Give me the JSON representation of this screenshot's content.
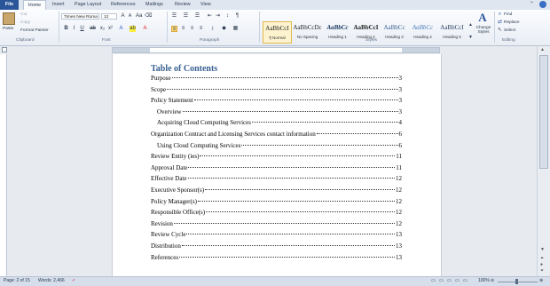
{
  "tabs": [
    "File",
    "Home",
    "Insert",
    "Page Layout",
    "References",
    "Mailings",
    "Review",
    "View"
  ],
  "clipboard": {
    "paste": "Paste",
    "cut": "Cut",
    "copy": "Copy",
    "format_painter": "Format Painter",
    "group": "Clipboard"
  },
  "font": {
    "name": "Times New Roma",
    "size": "12",
    "group": "Font"
  },
  "paragraph": {
    "group": "Paragraph"
  },
  "styles": {
    "items": [
      {
        "preview": "AaBbCcI",
        "name": "¶ Normal"
      },
      {
        "preview": "AaBbCcDc",
        "name": "No Spacing"
      },
      {
        "preview": "AaBbCc",
        "name": "Heading 1"
      },
      {
        "preview": "AaBbCcI",
        "name": "Heading 2"
      },
      {
        "preview": "AaBbCc",
        "name": "Heading 3"
      },
      {
        "preview": "AaBbCc",
        "name": "Heading 4"
      },
      {
        "preview": "AaBbCcI",
        "name": "Heading 5"
      }
    ],
    "change_styles": "Change Styles",
    "group": "Styles"
  },
  "editing": {
    "find": "Find",
    "replace": "Replace",
    "select": "Select",
    "group": "Editing"
  },
  "document": {
    "toc_title": "Table of Contents",
    "entries": [
      {
        "text": "Purpose",
        "page": "3",
        "indent": 0
      },
      {
        "text": "Scope",
        "page": "3",
        "indent": 0
      },
      {
        "text": "Policy Statement",
        "page": "3",
        "indent": 0
      },
      {
        "text": "Overview",
        "page": "3",
        "indent": 1
      },
      {
        "text": "Acquiring Cloud Computing Services",
        "page": "4",
        "indent": 1
      },
      {
        "text": "Organization Contract and Licensing Services contact information",
        "page": "6",
        "indent": 0
      },
      {
        "text": "Using Cloud Computing Services",
        "page": "6",
        "indent": 1
      },
      {
        "text": "Review Entity (ies)",
        "page": "11",
        "indent": 0
      },
      {
        "text": "Approval Date",
        "page": "11",
        "indent": 0
      },
      {
        "text": "Effective Date",
        "page": "12",
        "indent": 0
      },
      {
        "text": "Executive Sponsor(s)",
        "page": "12",
        "indent": 0
      },
      {
        "text": "Policy Manager(s)",
        "page": "12",
        "indent": 0
      },
      {
        "text": "Responsible Office(s)",
        "page": "12",
        "indent": 0
      },
      {
        "text": "Revision",
        "page": "12",
        "indent": 0
      },
      {
        "text": "Review Cycle",
        "page": "13",
        "indent": 0
      },
      {
        "text": "Distribution",
        "page": "13",
        "indent": 0
      },
      {
        "text": "References",
        "page": "13",
        "indent": 0
      }
    ]
  },
  "status": {
    "page": "Page: 2 of 15",
    "words": "Words: 2,466",
    "zoom": "100%"
  },
  "colors": {
    "file_tab": "#2a5699",
    "heading": "#365f91",
    "selected_style": "#fdf3cf"
  }
}
